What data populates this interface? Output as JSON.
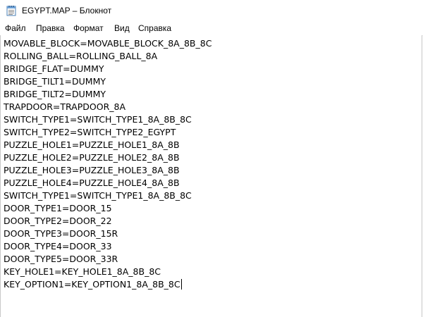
{
  "window": {
    "title": "EGYPT.MAP – Блокнот",
    "icon": "notepad-icon"
  },
  "menu": {
    "file": "Файл",
    "edit": "Правка",
    "format": "Формат",
    "view": "Вид",
    "help": "Справка"
  },
  "editor": {
    "lines": [
      "MOVABLE_BLOCK=MOVABLE_BLOCK_8A_8B_8C",
      "ROLLING_BALL=ROLLING_BALL_8A",
      "BRIDGE_FLAT=DUMMY",
      "BRIDGE_TILT1=DUMMY",
      "BRIDGE_TILT2=DUMMY",
      "TRAPDOOR=TRAPDOOR_8A",
      "SWITCH_TYPE1=SWITCH_TYPE1_8A_8B_8C",
      "SWITCH_TYPE2=SWITCH_TYPE2_EGYPT",
      "PUZZLE_HOLE1=PUZZLE_HOLE1_8A_8B",
      "PUZZLE_HOLE2=PUZZLE_HOLE2_8A_8B",
      "PUZZLE_HOLE3=PUZZLE_HOLE3_8A_8B",
      "PUZZLE_HOLE4=PUZZLE_HOLE4_8A_8B",
      "SWITCH_TYPE1=SWITCH_TYPE1_8A_8B_8C",
      "DOOR_TYPE1=DOOR_15",
      "DOOR_TYPE2=DOOR_22",
      "DOOR_TYPE3=DOOR_15R",
      "DOOR_TYPE4=DOOR_33",
      "DOOR_TYPE5=DOOR_33R",
      "KEY_HOLE1=KEY_HOLE1_8A_8B_8C",
      "KEY_OPTION1=KEY_OPTION1_8A_8B_8C"
    ]
  }
}
